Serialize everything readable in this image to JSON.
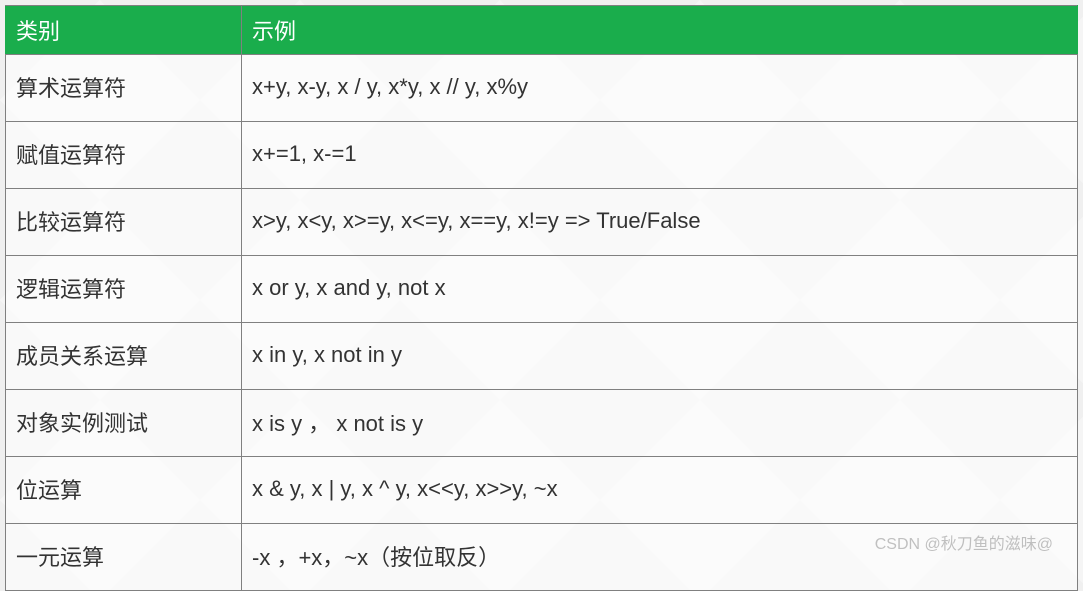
{
  "headers": {
    "category": "类别",
    "example": "示例"
  },
  "rows": [
    {
      "category": "算术运算符",
      "example": "x+y, x-y, x / y, x*y, x // y, x%y"
    },
    {
      "category": "赋值运算符",
      "example": "x+=1, x-=1"
    },
    {
      "category": "比较运算符",
      "example": "x>y, x<y, x>=y, x<=y, x==y, x!=y    => True/False"
    },
    {
      "category": "逻辑运算符",
      "example": "x or y, x and y, not x"
    },
    {
      "category": "成员关系运算",
      "example": "x in y, x not in y"
    },
    {
      "category": "对象实例测试",
      "example": "x is y ， x not is y"
    },
    {
      "category": "位运算",
      "example": "x & y, x | y, x ^ y, x<<y, x>>y, ~x"
    },
    {
      "category": "一元运算",
      "example": "-x ，+x，~x（按位取反）"
    }
  ],
  "watermark": "CSDN @秋刀鱼的滋味@"
}
